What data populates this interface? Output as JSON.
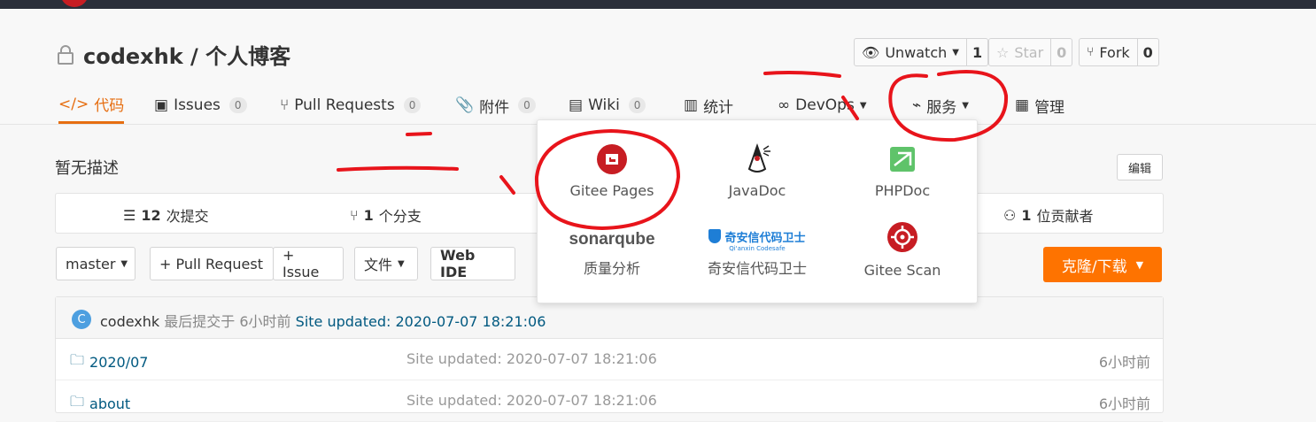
{
  "repo": {
    "title": "codexhk / 个人博客"
  },
  "repo_buttons": {
    "watch": {
      "label": "Unwatch",
      "count": "1"
    },
    "star": {
      "label": "Star",
      "count": "0"
    },
    "fork": {
      "label": "Fork",
      "count": "0"
    }
  },
  "tabs": [
    {
      "label": "代码",
      "icon": "code-icon"
    },
    {
      "label": "Issues",
      "count": "0",
      "icon": "issues-icon"
    },
    {
      "label": "Pull Requests",
      "count": "0",
      "icon": "pull-request-icon"
    },
    {
      "label": "附件",
      "count": "0",
      "icon": "paperclip-icon"
    },
    {
      "label": "Wiki",
      "count": "0",
      "icon": "book-icon"
    },
    {
      "label": "统计",
      "icon": "bar-chart-icon"
    },
    {
      "label": "DevOps",
      "icon": "infinity-icon"
    },
    {
      "label": "服务",
      "icon": "pulse-icon"
    },
    {
      "label": "管理",
      "icon": "settings-doc-icon"
    }
  ],
  "description": "暂无描述",
  "edit_label": "编辑",
  "stats": {
    "commits_count": "12",
    "commits_label": "次提交",
    "branches_count": "1",
    "branches_label": "个分支",
    "contributors_count": "1",
    "contributors_label": "位贡献者"
  },
  "toolbar": {
    "branch": "master",
    "pull_request": "+ Pull Request",
    "issue": "+ Issue",
    "files": "文件",
    "web_ide": "Web IDE",
    "clone": "克隆/下载"
  },
  "latest_commit": {
    "avatar_letter": "C",
    "author": "codexhk",
    "meta": "最后提交于 6小时前",
    "message": "Site updated: 2020-07-07 18:21:06"
  },
  "files": [
    {
      "name": "2020/07",
      "message": "Site updated: 2020-07-07 18:21:06",
      "time": "6小时前"
    },
    {
      "name": "about",
      "message": "Site updated: 2020-07-07 18:21:06",
      "time": "6小时前"
    }
  ],
  "services_menu": [
    {
      "label": "Gitee Pages",
      "icon": "gitee-pages-icon"
    },
    {
      "label": "JavaDoc",
      "icon": "javadoc-icon"
    },
    {
      "label": "PHPDoc",
      "icon": "phpdoc-icon"
    },
    {
      "label": "质量分析",
      "icon": "sonarqube-icon",
      "logo_text": "sonarqube"
    },
    {
      "label": "奇安信代码卫士",
      "icon": "qianxin-codesafe-icon",
      "logo_text": "奇安信代码卫士",
      "logo_sub": "Qi'anxin Codesafe"
    },
    {
      "label": "Gitee Scan",
      "icon": "gitee-scan-icon"
    }
  ],
  "colors": {
    "accent": "#e66e11",
    "clone": "#fe7300",
    "brand": "#c71d23",
    "annotation": "#e8141b"
  }
}
